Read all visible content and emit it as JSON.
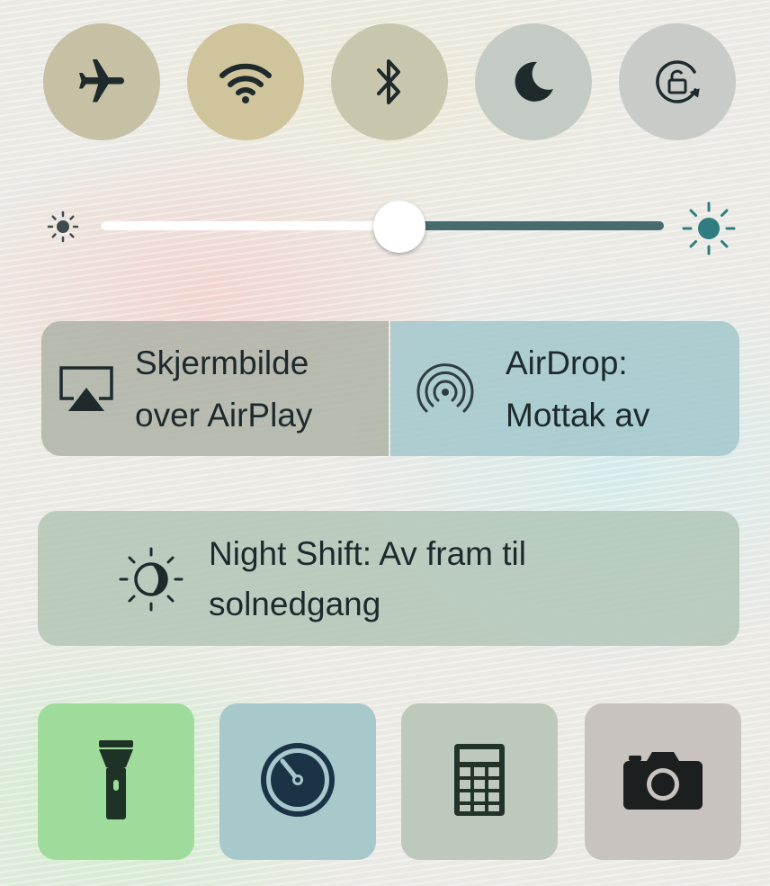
{
  "toggles": [
    {
      "id": "airplane-mode",
      "icon": "airplane-icon",
      "state": "off"
    },
    {
      "id": "wifi",
      "icon": "wifi-icon",
      "state": "on"
    },
    {
      "id": "bluetooth",
      "icon": "bluetooth-icon",
      "state": "off"
    },
    {
      "id": "do-not-disturb",
      "icon": "moon-icon",
      "state": "off"
    },
    {
      "id": "rotation-lock",
      "icon": "rotation-lock-icon",
      "state": "off"
    }
  ],
  "brightness": {
    "min_icon": "sun-small-icon",
    "max_icon": "sun-large-icon",
    "level": 0.53
  },
  "airplay": {
    "label_line1": "Skjermbilde",
    "label_line2": "over AirPlay",
    "icon": "airplay-icon"
  },
  "airdrop": {
    "label_line1": "AirDrop:",
    "label_line2": "Mottak av",
    "icon": "airdrop-icon"
  },
  "night_shift": {
    "label_line1": "Night Shift: Av fram til",
    "label_line2": "solnedgang",
    "icon": "night-shift-icon"
  },
  "quick_actions": [
    {
      "id": "flashlight",
      "icon": "flashlight-icon",
      "active": true
    },
    {
      "id": "timer",
      "icon": "timer-icon",
      "active": false
    },
    {
      "id": "calculator",
      "icon": "calculator-icon",
      "active": false
    },
    {
      "id": "camera",
      "icon": "camera-icon",
      "active": false
    }
  ],
  "colors": {
    "icon": "#1e2a2c",
    "slider_track_left": "#ffffff",
    "slider_track_right": "#476c6f",
    "flashlight_active": "#9fdc9c",
    "sun_max_accent": "#2f7d80"
  }
}
